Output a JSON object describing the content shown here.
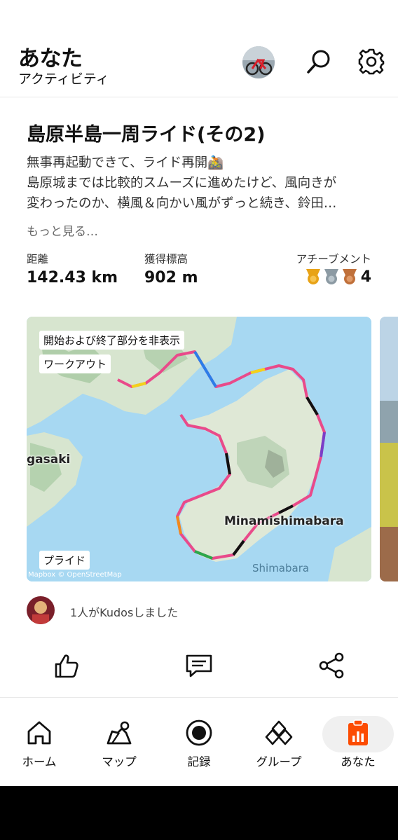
{
  "header": {
    "title": "あなた",
    "subtitle": "アクティビティ"
  },
  "activity": {
    "title": "島原半島一周ライド(その2)",
    "description_lines": [
      "無事再起動できて、ライド再開🚵",
      "島原城までは比較的スムーズに進めたけど、風向きが",
      "変わったのか、横風＆向かい風がずっと続き、鈴田…"
    ],
    "more": "もっと見る…",
    "stats": {
      "distance_label": "距離",
      "distance_value": "142.43 km",
      "elevation_label": "獲得標高",
      "elevation_value": "902 m",
      "achievements_label": "アチーブメント",
      "achievements_count": "4"
    }
  },
  "map": {
    "label_hide": "開始および終了部分を非表示",
    "label_workout": "ワークアウト",
    "label_pride": "プライド",
    "place_1": "gasaki",
    "place_2": "Minamishimabara",
    "place_3": "Shimabara",
    "attribution": "Mapbox © OpenStreetMap"
  },
  "kudos": {
    "text": "1人がKudosしました"
  },
  "nav": {
    "items": [
      {
        "label": "ホーム",
        "icon": "home-icon"
      },
      {
        "label": "マップ",
        "icon": "map-icon"
      },
      {
        "label": "記録",
        "icon": "record-icon"
      },
      {
        "label": "グループ",
        "icon": "groups-icon"
      },
      {
        "label": "あなた",
        "icon": "you-icon"
      }
    ],
    "active": "あなた"
  },
  "colors": {
    "accent": "#fc4c02",
    "gold": "#e8a317",
    "silver": "#8c9aa3",
    "bronze": "#c0703a"
  }
}
